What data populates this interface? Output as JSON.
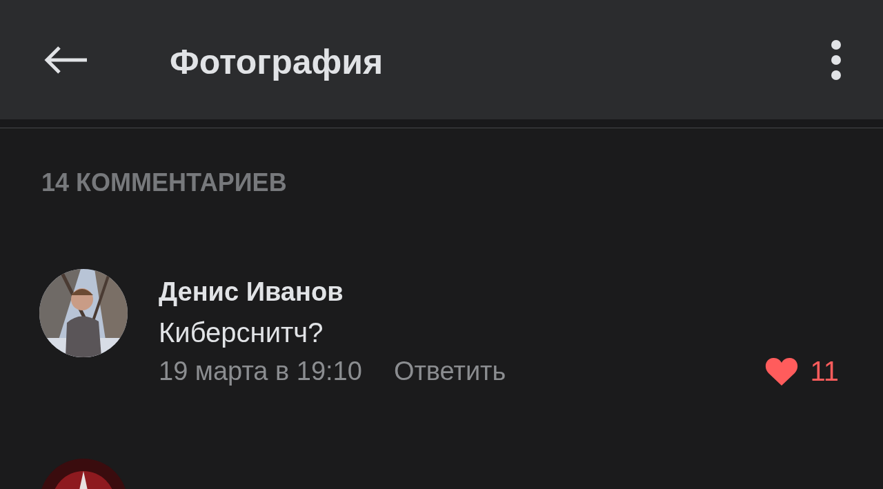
{
  "header": {
    "title": "Фотография"
  },
  "comments_count": "14 КОММЕНТАРИЕВ",
  "comments": [
    {
      "avatar": {
        "kind": "picture"
      },
      "author": "Денис Иванов",
      "text": "Киберснитч?",
      "date": "19 марта в 19:10",
      "reply": "Ответить",
      "liked": true,
      "likes": "11"
    },
    {
      "avatar": {
        "kind": "picture"
      }
    }
  ]
}
